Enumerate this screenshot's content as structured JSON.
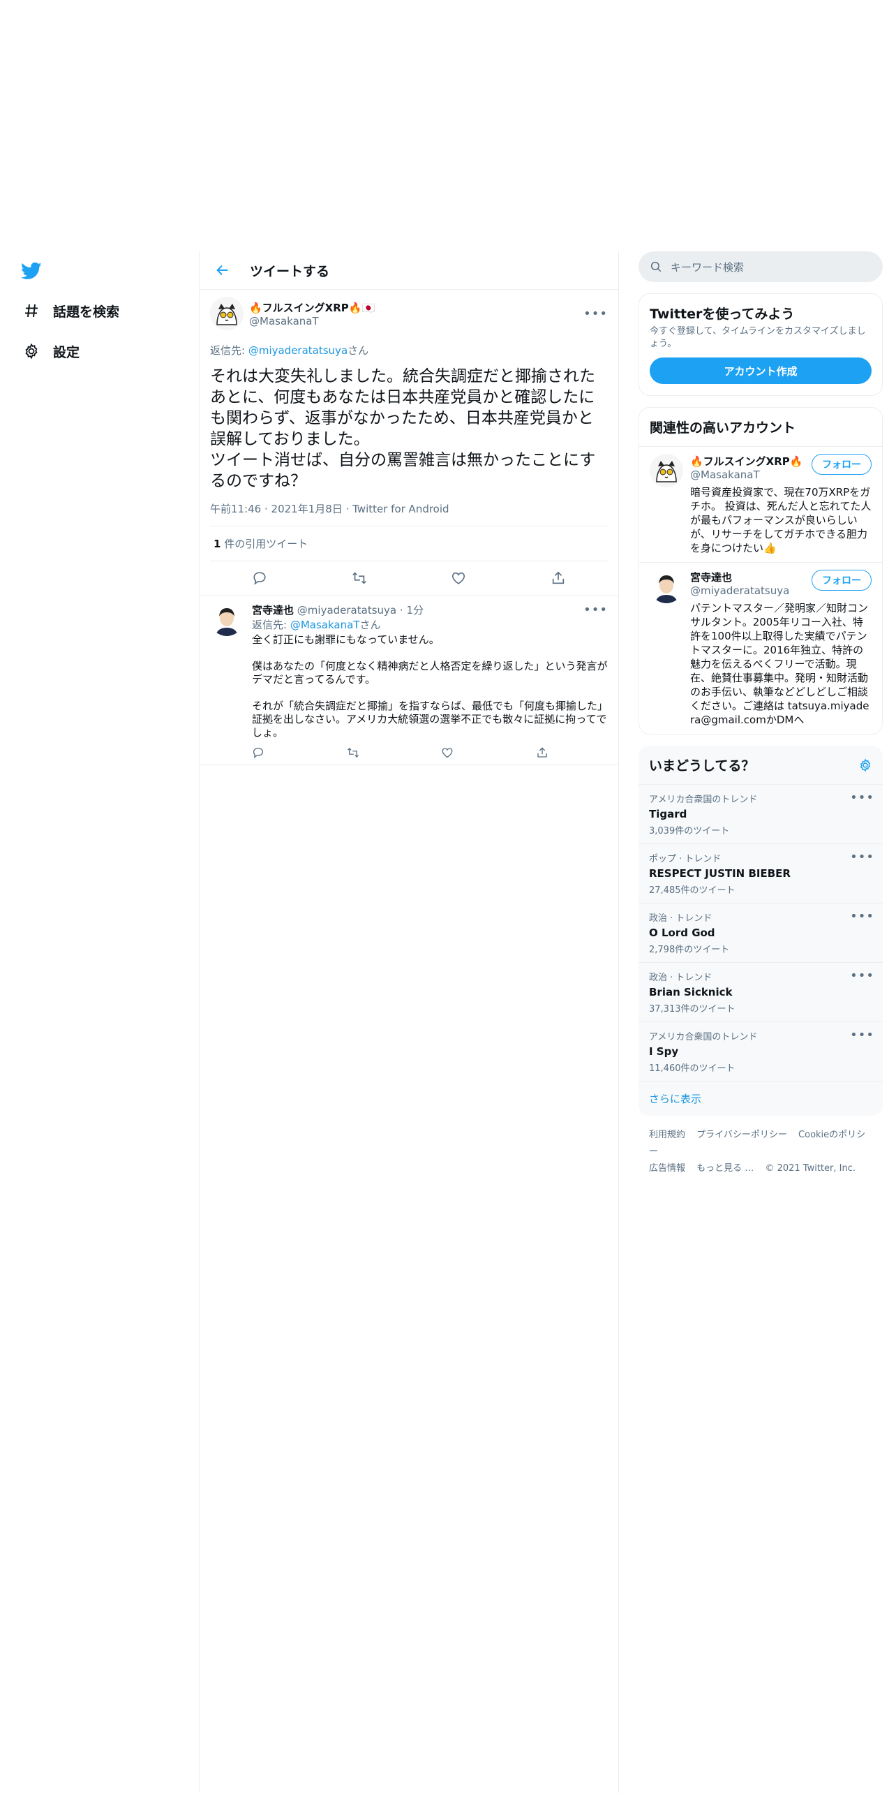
{
  "nav": {
    "explore_label": "話題を検索",
    "settings_label": "設定"
  },
  "main": {
    "header_title": "ツイートする",
    "focused_tweet": {
      "display_name": "🔥フルスイングXRP🔥🇯🇵",
      "handle": "@MasakanaT",
      "reply_prefix": "返信先: ",
      "reply_handle": "@miyaderatatsuya",
      "reply_suffix": "さん",
      "text": "それは大変失礼しました。統合失調症だと揶揄されたあとに、何度もあなたは日本共産党員かと確認したにも関わらず、返事がなかったため、日本共産党員かと誤解しておりました。\nツイート消せば、自分の罵詈雑言は無かったことにするのですね？",
      "time": "午前11:46",
      "date": "2021年1月8日",
      "source": "Twitter for Android",
      "quote_count": "1",
      "quote_label": "件の引用ツイート"
    },
    "reply_tweet": {
      "display_name": "宮寺達也",
      "handle": "@miyaderatatsuya",
      "time": "1分",
      "reply_prefix": "返信先: ",
      "reply_handle": "@MasakanaT",
      "reply_suffix": "さん",
      "text": "全く訂正にも謝罪にもなっていません。\n\n僕はあなたの「何度となく精神病だと人格否定を繰り返した」という発言がデマだと言ってるんです。\n\nそれが「統合失調症だと揶揄」を指すならば、最低でも「何度も揶揄した」証拠を出しなさい。アメリカ大統領選の選挙不正でも散々に証拠に拘ってでしょ。"
    }
  },
  "right": {
    "search_placeholder": "キーワード検索",
    "signup": {
      "title": "Twitterを使ってみよう",
      "subtitle": "今すぐ登録して、タイムラインをカスタマイズしましょう。",
      "button": "アカウント作成"
    },
    "related": {
      "title": "関連性の高いアカウント",
      "follow_label": "フォロー",
      "accounts": [
        {
          "name": "🔥フルスイングXRP🔥",
          "handle": "@MasakanaT",
          "bio": "暗号資産投資家で、現在70万XRPをガチホ。 投資は、死んだ人と忘れてた人が最もパフォーマンスが良いらしいが、リサーチをしてガチホできる胆力を身につけたい👍"
        },
        {
          "name": "宮寺達也",
          "handle": "@miyaderatatsuya",
          "bio": "パテントマスター／発明家／知財コンサルタント。2005年リコー入社、特許を100件以上取得した実績でパテントマスターに。2016年独立、特許の魅力を伝えるべくフリーで活動。現在、絶賛仕事募集中。発明・知財活動のお手伝い、執筆などどしどしご相談ください。ご連絡は tatsuya.miyadera@gmail.comかDMへ"
        }
      ]
    },
    "trends": {
      "title": "いまどうしてる？",
      "items": [
        {
          "category": "アメリカ合衆国のトレンド",
          "name": "Tigard",
          "count": "3,039件のツイート"
        },
        {
          "category": "ポップ · トレンド",
          "name": "RESPECT JUSTIN BIEBER",
          "count": "27,485件のツイート"
        },
        {
          "category": "政治 · トレンド",
          "name": "O Lord God",
          "count": "2,798件のツイート"
        },
        {
          "category": "政治 · トレンド",
          "name": "Brian Sicknick",
          "count": "37,313件のツイート"
        },
        {
          "category": "アメリカ合衆国のトレンド",
          "name": "I Spy",
          "count": "11,460件のツイート"
        }
      ],
      "show_more": "さらに表示"
    },
    "footer": {
      "links": [
        "利用規約",
        "プライバシーポリシー",
        "Cookieのポリシー",
        "広告情報",
        "もっと見る …"
      ],
      "copyright": "© 2021 Twitter, Inc."
    }
  },
  "colors": {
    "accent": "#1da1f2",
    "link": "#1b95e0",
    "muted": "#5b7083",
    "border": "#ebeef0"
  }
}
